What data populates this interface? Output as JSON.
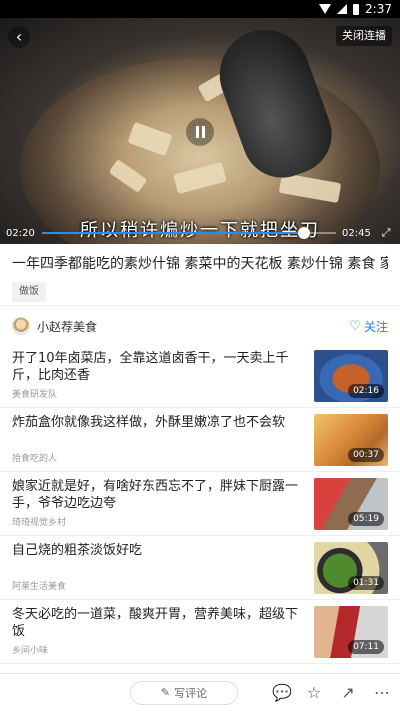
{
  "status_bar": {
    "time": "2:37"
  },
  "video": {
    "close_autoplay_label": "关闭连播",
    "subtitle": "所以稍许煸炒一下就把坐刀",
    "current_time": "02:20",
    "total_time": "02:45",
    "progress": 0.89,
    "progress_color": "#2b8cf0"
  },
  "content": {
    "title": "一年四季都能吃的素炒什锦 素菜中的天花板 素炒什锦 素食 家常菜",
    "tag": "做饭"
  },
  "author": {
    "name": "小赵荐美食",
    "follow_label": "关注"
  },
  "related": [
    {
      "title": "开了10年卤菜店，全靠这道卤香干，一天卖上千斤，比肉还香",
      "source": "美食研发队",
      "duration": "02:16"
    },
    {
      "title": "炸茄盒你就像我这样做，外酥里嫩凉了也不会软",
      "source": "拾食吃的人",
      "duration": "00:37"
    },
    {
      "title": "娘家近就是好，有啥好东西忘不了，胖妹下厨露一手，爷爷边吃边夸",
      "source": "琦琦视觉乡村",
      "duration": "05:19"
    },
    {
      "title": "自己烧的粗茶淡饭好吃",
      "source": "阿莱生活美食",
      "duration": "01:31"
    },
    {
      "title": "冬天必吃的一道菜，酸爽开胃，营养美味，超级下饭",
      "source": "乡间小味",
      "duration": "07:11"
    }
  ],
  "bottom_bar": {
    "comment_placeholder": "写评论"
  }
}
